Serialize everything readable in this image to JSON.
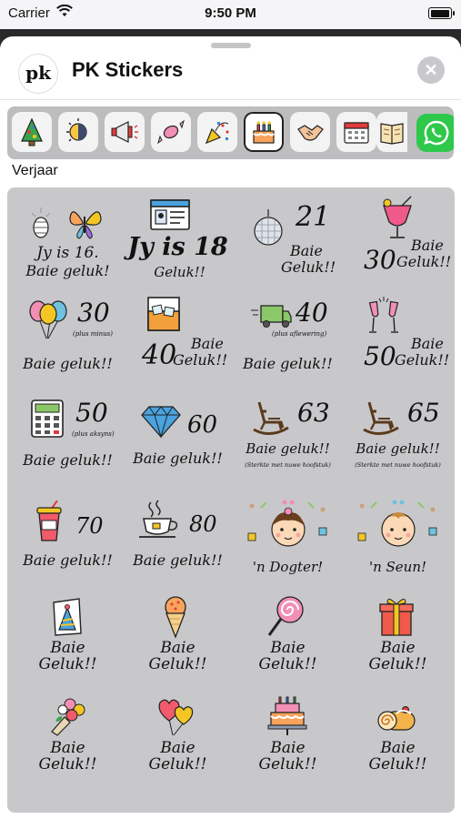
{
  "status_bar": {
    "carrier": "Carrier",
    "time": "9:50 PM"
  },
  "header": {
    "title": "PK Stickers",
    "logo_text": "pk",
    "close_label": "✕"
  },
  "tabs": [
    {
      "icon": "christmas-tree-icon"
    },
    {
      "icon": "sun-moon-icon"
    },
    {
      "icon": "megaphone-icon"
    },
    {
      "icon": "candy-icon"
    },
    {
      "icon": "party-popper-icon"
    },
    {
      "icon": "birthday-cake-icon",
      "selected": true
    },
    {
      "icon": "handshake-icon"
    },
    {
      "icon": "calendar-icon"
    },
    {
      "icon": "book-icon"
    },
    {
      "icon": "whatsapp-icon"
    }
  ],
  "section": {
    "label": "Verjaar"
  },
  "stickers": [
    {
      "icon": "butterfly-icon",
      "line1": "Jy is 16.",
      "line2": "Baie geluk!"
    },
    {
      "icon": "id-card-icon",
      "line1": "Jy is 18",
      "line2": "Geluk!!"
    },
    {
      "icon": "disco-ball-icon",
      "num": "21",
      "line1": "Baie",
      "line2": "Geluk!!"
    },
    {
      "icon": "cocktail-icon",
      "num": "30",
      "line1": "Baie",
      "line2": "Geluk!!"
    },
    {
      "icon": "balloons-icon",
      "num": "30",
      "small": "(plus minus)",
      "line2": "Baie geluk!!"
    },
    {
      "icon": "whisky-glass-icon",
      "num": "40",
      "line1": "Baie",
      "line2": "Geluk!!"
    },
    {
      "icon": "delivery-truck-icon",
      "num": "40",
      "small": "(plus aflewering)",
      "line2": "Baie geluk!!"
    },
    {
      "icon": "champagne-glasses-icon",
      "num": "50",
      "line1": "Baie",
      "line2": "Geluk!!"
    },
    {
      "icon": "calculator-icon",
      "num": "50",
      "small": "(plus aksyns)",
      "line2": "Baie geluk!!"
    },
    {
      "icon": "diamond-icon",
      "num": "60",
      "line2": "Baie geluk!!"
    },
    {
      "icon": "rocking-chair-icon",
      "num": "63",
      "line1": "Baie geluk!!",
      "small": "(Sterkte met nuwe hoofstuk)"
    },
    {
      "icon": "rocking-chair-icon",
      "num": "65",
      "line1": "Baie geluk!!",
      "small": "(Sterkte met nuwe hoofstuk)"
    },
    {
      "icon": "soda-cup-icon",
      "num": "70",
      "line2": "Baie geluk!!"
    },
    {
      "icon": "teacup-icon",
      "num": "80",
      "line2": "Baie geluk!!"
    },
    {
      "icon": "baby-girl-icon",
      "line2": "'n Dogter!"
    },
    {
      "icon": "baby-boy-icon",
      "line2": "'n Seun!"
    },
    {
      "icon": "party-hat-card-icon",
      "line1": "Baie",
      "line2": "Geluk!!"
    },
    {
      "icon": "ice-cream-icon",
      "line1": "Baie",
      "line2": "Geluk!!"
    },
    {
      "icon": "lollipop-icon",
      "line1": "Baie",
      "line2": "Geluk!!"
    },
    {
      "icon": "gift-box-icon",
      "line1": "Baie",
      "line2": "Geluk!!"
    },
    {
      "icon": "flower-bouquet-icon",
      "line1": "Baie",
      "line2": "Geluk!!"
    },
    {
      "icon": "heart-balloons-icon",
      "line1": "Baie",
      "line2": "Geluk!!"
    },
    {
      "icon": "cake-icon",
      "line1": "Baie",
      "line2": "Geluk!!"
    },
    {
      "icon": "swiss-roll-icon",
      "line1": "Baie",
      "line2": "Geluk!!"
    }
  ],
  "colors": {
    "whatsapp": "#2ec84b",
    "panel": "#c8c8cb",
    "tab_bar": "#bdbdc0"
  }
}
